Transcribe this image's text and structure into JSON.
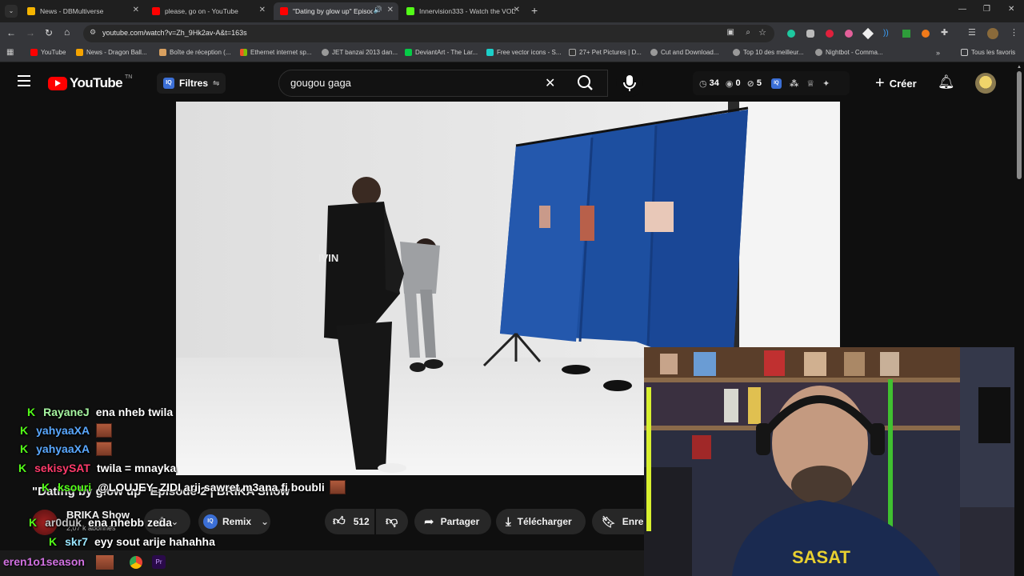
{
  "browser": {
    "tabs": [
      {
        "title": "News - DBMultiverse",
        "active": false,
        "color": "#f5b400"
      },
      {
        "title": "please, go on - YouTube",
        "active": false,
        "color": "#ff0000"
      },
      {
        "title": "\"Dating by glow up\" Episod",
        "active": true,
        "color": "#ff0000"
      },
      {
        "title": "Innervision333 - Watch the VOD",
        "active": false,
        "color": "#53fc18"
      }
    ],
    "new_tab": "+",
    "url": "youtube.com/watch?v=Zh_9Hk2av-A&t=163s",
    "bookmarks": [
      "YouTube",
      "News - Dragon Ball...",
      "Boîte de réception (...",
      "Ethernet internet sp...",
      "JET banzai 2013 dan...",
      "DeviantArt - The Lar...",
      "Free vector icons - S...",
      "27+ Pet Pictures | D...",
      "Cut and Download...",
      "Top 10 des meilleur...",
      "Nightbot - Comma..."
    ],
    "all_bookmarks": "Tous les favoris"
  },
  "youtube": {
    "logo_text": "YouTube",
    "logo_country": "TN",
    "filters_label": "Filtres",
    "search_value": "gougou gaga",
    "stats": {
      "views": "34",
      "eye": "0",
      "hidden": "5"
    },
    "create_label": "Créer",
    "video_title": "\"Dating by glow up\" Episode 2 | BRIKA Show",
    "channel_name": "BRIKA Show",
    "subscribers": "2,07 k abonnés",
    "remix_label": "Remix",
    "likes": "512",
    "share_label": "Partager",
    "download_label": "Télécharger",
    "save_label": "Enreg"
  },
  "chat": [
    {
      "user": "RayaneJ",
      "color": "#a6f5a0",
      "message": "ena nheb twila",
      "emote": false
    },
    {
      "user": "yahyaaXA",
      "color": "#5aa8ff",
      "message": "",
      "emote": true
    },
    {
      "user": "yahyaaXA",
      "color": "#5aa8ff",
      "message": "",
      "emote": true
    },
    {
      "user": "sekisySAT",
      "color": "#ff3b6b",
      "message": "twila = mnayka",
      "emote": false
    },
    {
      "user": "ksouri",
      "color": "#53fc18",
      "message": "@LOUJEY_ZIDI arij sawret m3ana fi boubli",
      "emote": true
    },
    {
      "user": "ar0duk",
      "color": "#c0c0c0",
      "message": "ena nhebb zeda",
      "emote": false
    },
    {
      "user": "skr7",
      "color": "#9be7ff",
      "message": "eyy sout arije hahahha",
      "emote": false
    }
  ],
  "taskbar_text": "eren1o1season"
}
